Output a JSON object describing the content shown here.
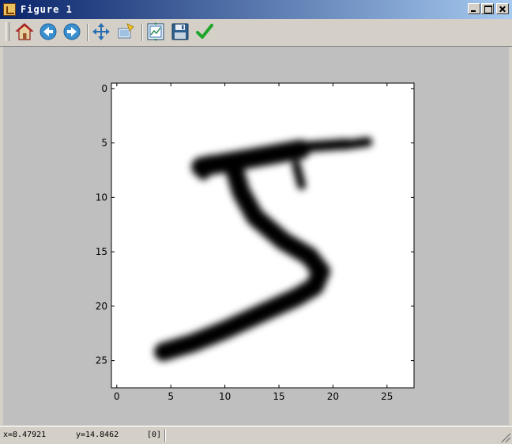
{
  "window": {
    "title": "Figure 1"
  },
  "toolbar": {
    "buttons": [
      {
        "name": "home-button",
        "icon": "home-icon"
      },
      {
        "name": "back-button",
        "icon": "back-arrow-icon"
      },
      {
        "name": "forward-button",
        "icon": "forward-arrow-icon"
      },
      {
        "name": "pan-button",
        "icon": "move-cross-icon"
      },
      {
        "name": "zoom-button",
        "icon": "zoom-rect-icon"
      },
      {
        "name": "subplots-button",
        "icon": "subplots-icon"
      },
      {
        "name": "save-button",
        "icon": "floppy-disk-icon"
      },
      {
        "name": "edit-params-button",
        "icon": "checkmark-icon"
      }
    ]
  },
  "chart_data": {
    "type": "heatmap",
    "colormap": "gray_r",
    "title": "",
    "xlabel": "",
    "ylabel": "",
    "xlim": [
      -0.5,
      27.5
    ],
    "ylim": [
      27.5,
      -0.5
    ],
    "xticks": [
      0,
      5,
      10,
      15,
      20,
      25
    ],
    "yticks": [
      0,
      5,
      10,
      15,
      20,
      25
    ],
    "grid": false,
    "image_description": "28x28 grayscale handwritten digit 5 (MNIST)",
    "strokes": [
      {
        "points": [
          [
            7.8,
            7.2
          ],
          [
            12.5,
            6.4
          ],
          [
            17,
            5.6
          ]
        ],
        "width": 1.8
      },
      {
        "points": [
          [
            17,
            5.4
          ],
          [
            19.8,
            5.2
          ],
          [
            21.2,
            5.1
          ]
        ],
        "width": 1.0
      },
      {
        "points": [
          [
            21,
            5.2
          ],
          [
            23.2,
            4.9
          ]
        ],
        "width": 0.9
      },
      {
        "points": [
          [
            8.6,
            6.7
          ],
          [
            8.0,
            7.8
          ]
        ],
        "width": 1.2
      },
      {
        "points": [
          [
            10.8,
            7.2
          ],
          [
            11.5,
            9.5
          ],
          [
            12.8,
            11.8
          ],
          [
            15.4,
            14.0
          ],
          [
            17.8,
            15.4
          ],
          [
            18.9,
            16.8
          ],
          [
            18.3,
            18.2
          ],
          [
            16.6,
            19.2
          ],
          [
            13.5,
            20.6
          ],
          [
            10.0,
            22.2
          ],
          [
            7.0,
            23.4
          ],
          [
            4.3,
            24.2
          ]
        ],
        "width": 1.7
      },
      {
        "points": [
          [
            16.6,
            7.0
          ],
          [
            17.1,
            8.9
          ]
        ],
        "width": 0.8
      }
    ]
  },
  "status": {
    "x_readout": "x=8.47921",
    "y_readout": "y=14.8462",
    "value_readout": "[0]"
  }
}
